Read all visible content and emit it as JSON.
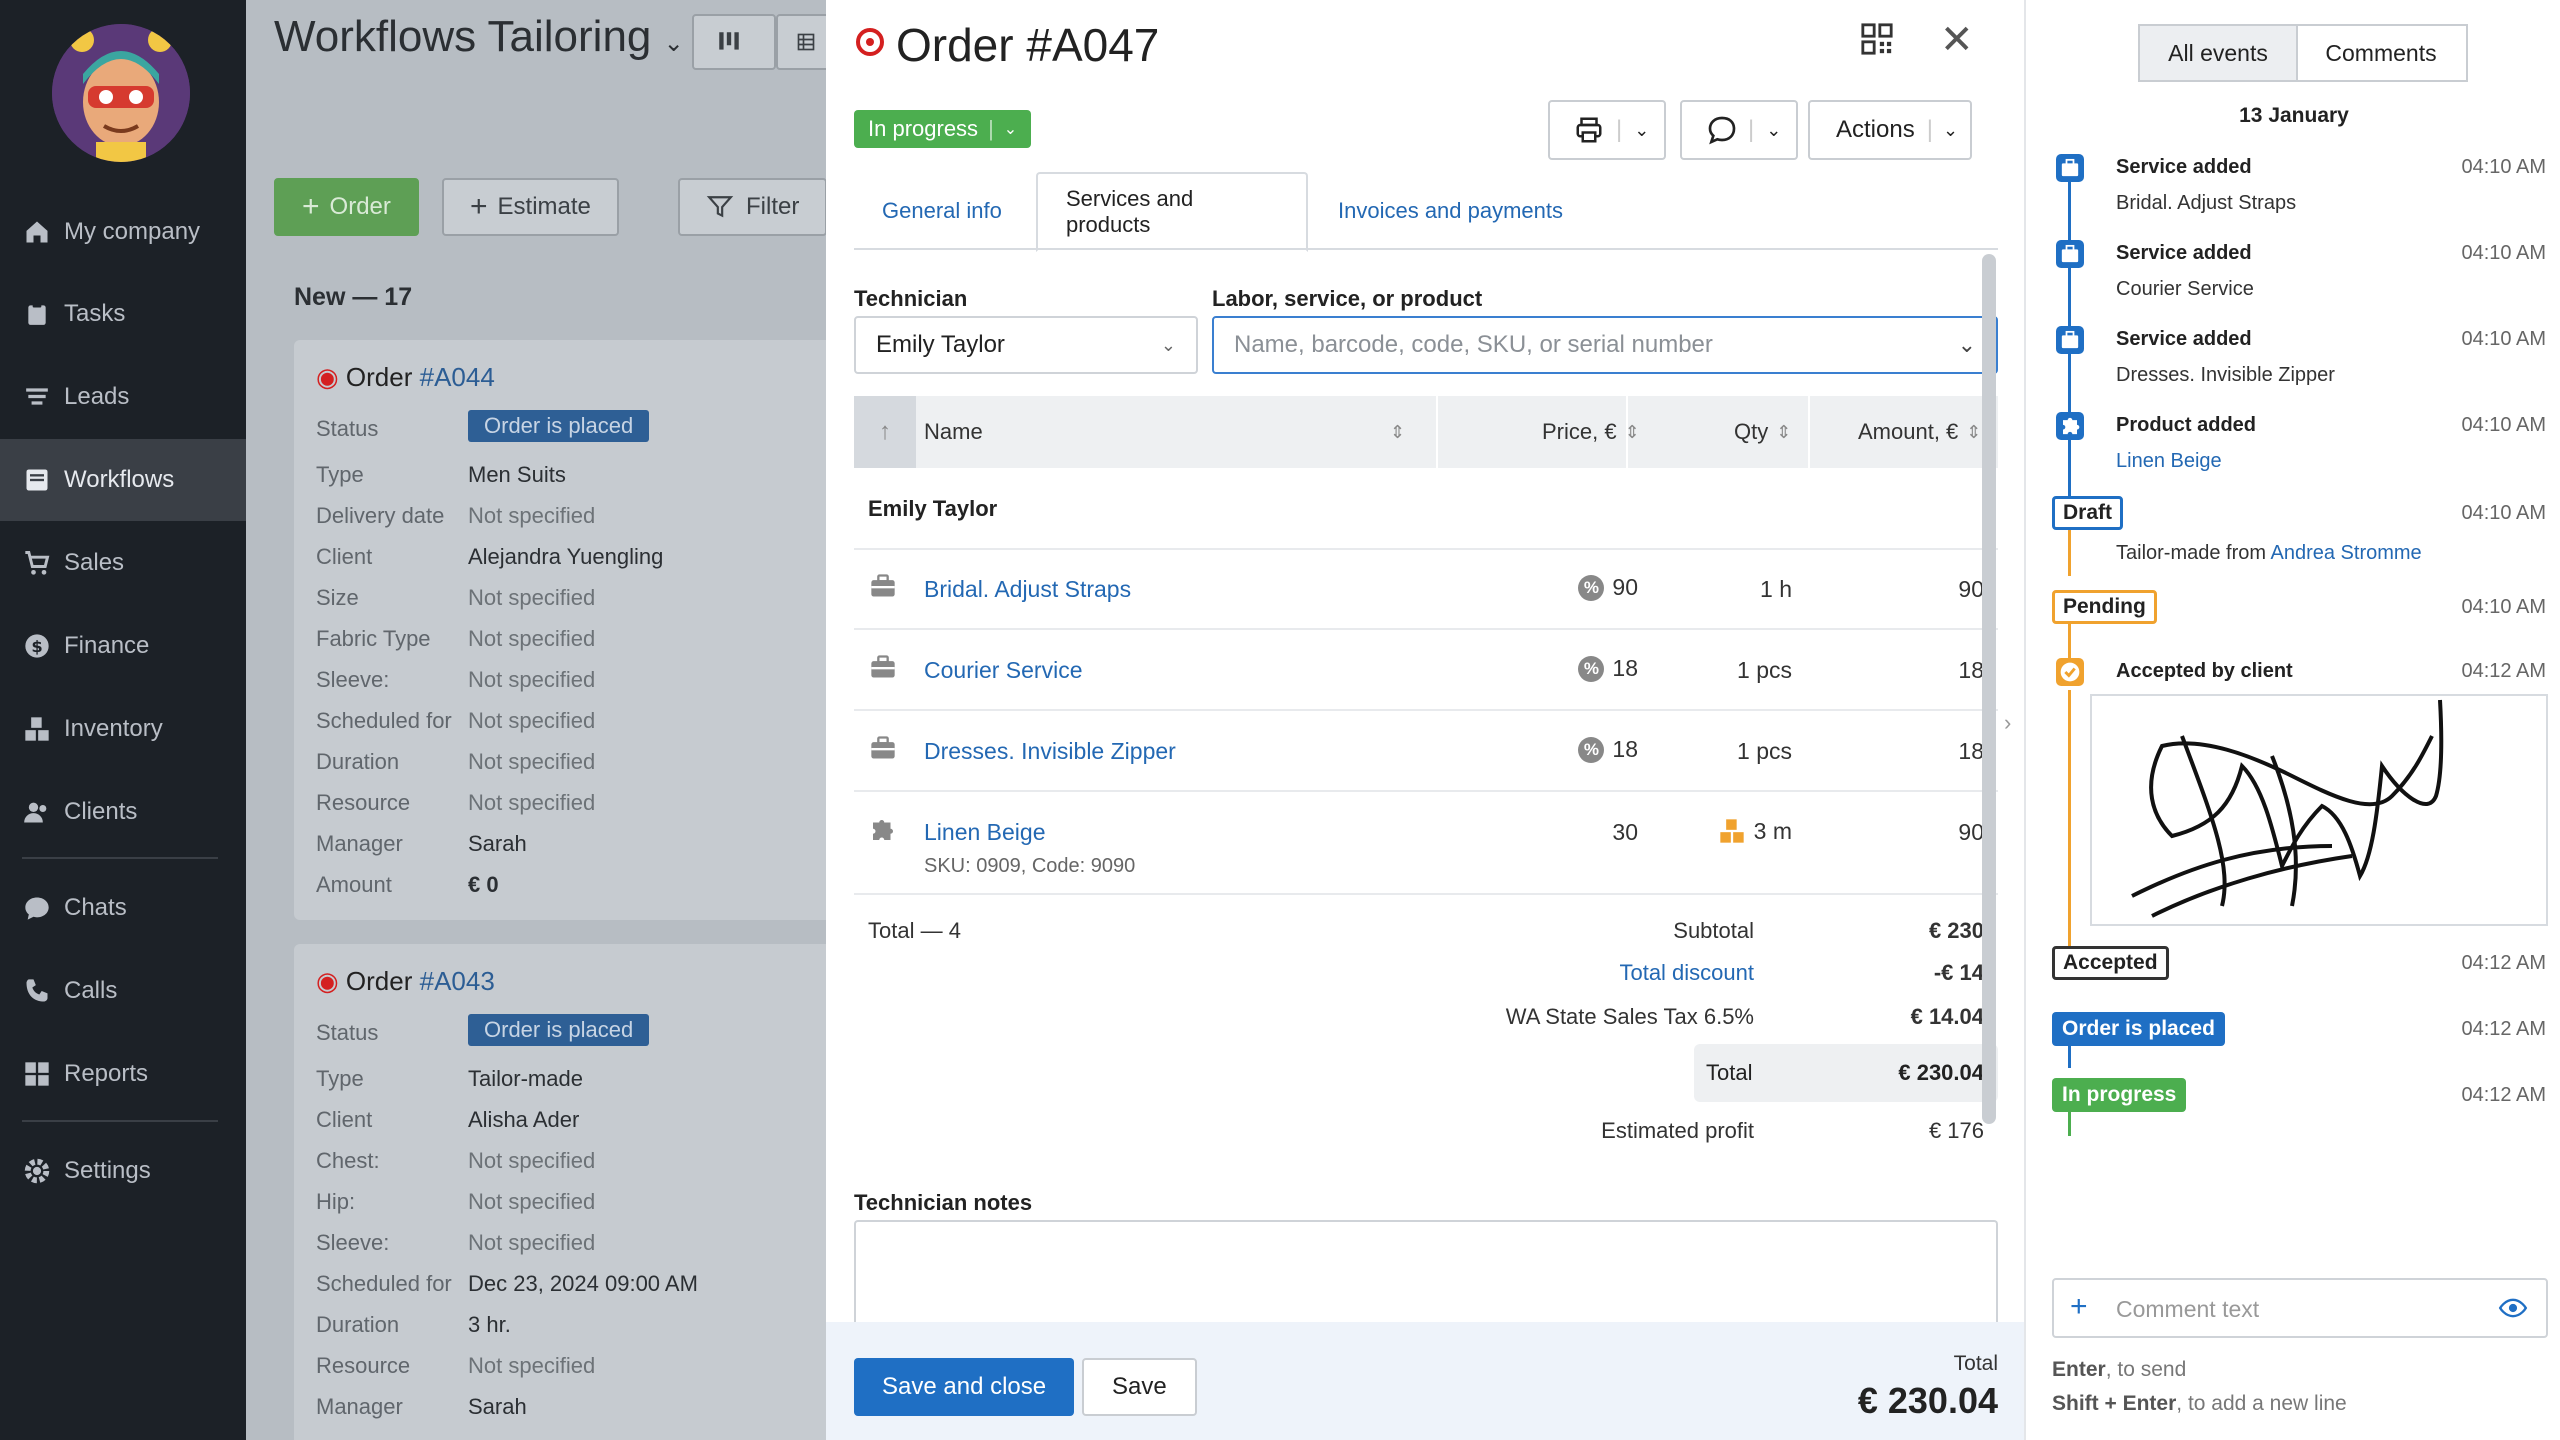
{
  "sidebar": {
    "items": [
      {
        "label": "My company",
        "icon": "home-icon"
      },
      {
        "label": "Tasks",
        "icon": "clipboard-icon"
      },
      {
        "label": "Leads",
        "icon": "funnel-icon"
      },
      {
        "label": "Workflows",
        "icon": "workflow-icon"
      },
      {
        "label": "Sales",
        "icon": "cart-icon"
      },
      {
        "label": "Finance",
        "icon": "dollar-icon"
      },
      {
        "label": "Inventory",
        "icon": "boxes-icon"
      },
      {
        "label": "Clients",
        "icon": "users-icon"
      },
      {
        "label": "Chats",
        "icon": "chat-icon"
      },
      {
        "label": "Calls",
        "icon": "phone-icon"
      },
      {
        "label": "Reports",
        "icon": "grid-icon"
      },
      {
        "label": "Settings",
        "icon": "gear-icon"
      }
    ]
  },
  "background": {
    "title": "Workflows Tailoring",
    "buttons": {
      "order": "Order",
      "estimate": "Estimate",
      "filter": "Filter"
    },
    "column": "New — 17",
    "cards": [
      {
        "title": "Order ",
        "number": "#A044",
        "rows": [
          [
            "Status",
            "Order is placed"
          ],
          [
            "Type",
            "Men Suits"
          ],
          [
            "Delivery date",
            "Not specified"
          ],
          [
            "Client",
            "Alejandra Yuengling"
          ],
          [
            "Size",
            "Not specified"
          ],
          [
            "Fabric Type",
            "Not specified"
          ],
          [
            "Sleeve:",
            "Not specified"
          ],
          [
            "Scheduled for",
            "Not specified"
          ],
          [
            "Duration",
            "Not specified"
          ],
          [
            "Resource",
            "Not specified"
          ],
          [
            "Manager",
            "Sarah"
          ],
          [
            "Amount",
            "€ 0"
          ]
        ]
      },
      {
        "title": "Order ",
        "number": "#A043",
        "rows": [
          [
            "Status",
            "Order is placed"
          ],
          [
            "Type",
            "Tailor-made"
          ],
          [
            "Client",
            "Alisha Ader"
          ],
          [
            "Chest:",
            "Not specified"
          ],
          [
            "Hip:",
            "Not specified"
          ],
          [
            "Sleeve:",
            "Not specified"
          ],
          [
            "Scheduled for",
            "Dec 23, 2024 09:00 AM"
          ],
          [
            "Duration",
            "3 hr."
          ],
          [
            "Resource",
            "Not specified"
          ],
          [
            "Manager",
            "Sarah"
          ]
        ]
      }
    ]
  },
  "modal": {
    "title": "Order #A047",
    "status": "In progress",
    "actions_label": "Actions",
    "tabs": [
      "General info",
      "Services and products",
      "Invoices and payments"
    ],
    "technician_label": "Technician",
    "technician_value": "Emily Taylor",
    "product_label": "Labor, service, or product",
    "product_placeholder": "Name, barcode, code, SKU, or serial number",
    "columns": {
      "name": "Name",
      "price": "Price, €",
      "qty": "Qty",
      "amount": "Amount, €"
    },
    "group": "Emily Taylor",
    "rows": [
      {
        "name": "Bridal. Adjust Straps",
        "price": "90",
        "qty": "1 h",
        "amount": "90",
        "icon": "toolbox-icon"
      },
      {
        "name": "Courier Service",
        "price": "18",
        "qty": "1 pcs",
        "amount": "18",
        "icon": "toolbox-icon"
      },
      {
        "name": "Dresses. Invisible Zipper",
        "price": "18",
        "qty": "1 pcs",
        "amount": "18",
        "icon": "toolbox-icon"
      },
      {
        "name": "Linen Beige",
        "sub": "SKU: 0909, Code: 9090",
        "price": "30",
        "qty": "3 m",
        "amount": "90",
        "icon": "puzzle-icon"
      }
    ],
    "totals": {
      "count": "Total — 4",
      "subtotal_label": "Subtotal",
      "subtotal": "€ 230",
      "discount_label": "Total discount",
      "discount": "-€ 14",
      "tax_label": "WA State Sales Tax 6.5%",
      "tax": "€ 14.04",
      "total_label": "Total",
      "total": "€ 230.04",
      "profit_label": "Estimated profit",
      "profit": "€ 176"
    },
    "notes_label": "Technician notes",
    "footer": {
      "save_close": "Save and close",
      "save": "Save",
      "total_label": "Total",
      "total": "€ 230.04"
    }
  },
  "panel": {
    "tabs": [
      "All events",
      "Comments"
    ],
    "date": "13 January",
    "events": [
      {
        "title": "Service added",
        "time": "04:10 AM",
        "sub": "Bridal. Adjust Straps"
      },
      {
        "title": "Service added",
        "time": "04:10 AM",
        "sub": "Courier Service"
      },
      {
        "title": "Service added",
        "time": "04:10 AM",
        "sub": "Dresses. Invisible Zipper"
      },
      {
        "title": "Product added",
        "time": "04:10 AM",
        "sub": "Linen Beige"
      },
      {
        "tag": "Draft",
        "time": "04:10 AM",
        "sub_prefix": "Tailor-made from ",
        "sub_link": "Andrea Stromme"
      },
      {
        "tag": "Pending",
        "time": "04:10 AM"
      },
      {
        "title": "Accepted by client",
        "time": "04:12 AM"
      },
      {
        "tag": "Accepted",
        "time": "04:12 AM"
      },
      {
        "tag": "Order is placed",
        "time": "04:12 AM"
      },
      {
        "tag": "In progress",
        "time": "04:12 AM"
      }
    ],
    "comment_placeholder": "Comment text",
    "hint1_key": "Enter",
    "hint1": ", to send",
    "hint2_key": "Shift + Enter",
    "hint2": ", to add a new line"
  }
}
